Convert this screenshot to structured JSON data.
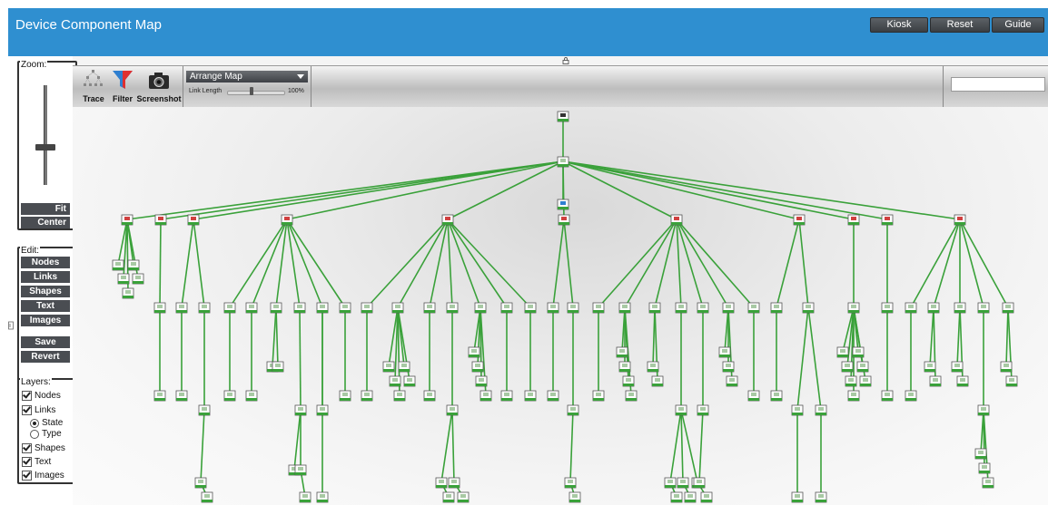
{
  "header": {
    "title": "Device Component Map",
    "buttons": [
      "Kiosk",
      "Reset",
      "Guide"
    ]
  },
  "sidebar": {
    "zoom_legend": "Zoom:",
    "zoom_buttons": [
      "Fit",
      "Center"
    ],
    "edit_legend": "Edit:",
    "edit_buttons": [
      "Nodes",
      "Links",
      "Shapes",
      "Text",
      "Images",
      "Save",
      "Revert"
    ],
    "layers_legend": "Layers:",
    "layers": {
      "nodes": "Nodes",
      "links": "Links",
      "state": "State",
      "type": "Type",
      "shapes": "Shapes",
      "text": "Text",
      "images": "Images"
    }
  },
  "toolbar": {
    "trace": "Trace",
    "filter": "Filter",
    "screenshot": "Screenshot",
    "arrange": "Arrange Map",
    "link_length_label": "Link Length",
    "link_length_value": "100%",
    "search_value": ""
  },
  "colors": {
    "header": "#2f8fd0",
    "link": "#3aa13a",
    "button": "#4a4d52"
  },
  "icons": [
    "lock-icon",
    "trace-icon",
    "filter-icon",
    "camera-icon",
    "chevron-down-icon",
    "device-node-icon"
  ]
}
